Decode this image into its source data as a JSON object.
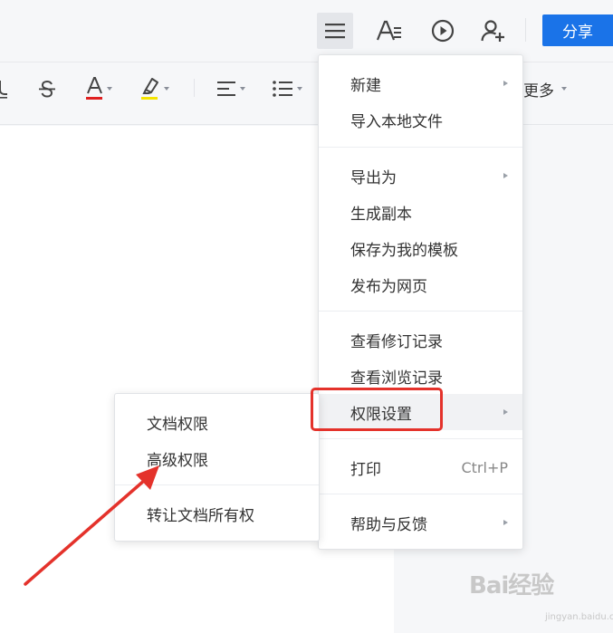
{
  "header": {
    "share_label": "分享"
  },
  "toolbar": {
    "more_label": "更多",
    "underline_glyph": "U",
    "strike_glyph": "S",
    "font_color_glyph": "A",
    "font_color": "#e02020",
    "highlight_color": "#f5e400"
  },
  "main_menu": {
    "items": [
      {
        "label": "新建",
        "submenu": true
      },
      {
        "label": "导入本地文件"
      },
      {
        "label": "导出为",
        "submenu": true
      },
      {
        "label": "生成副本"
      },
      {
        "label": "保存为我的模板"
      },
      {
        "label": "发布为网页"
      },
      {
        "label": "查看修订记录"
      },
      {
        "label": "查看浏览记录"
      },
      {
        "label": "权限设置",
        "submenu": true,
        "active": true
      },
      {
        "label": "打印",
        "shortcut": "Ctrl+P"
      },
      {
        "label": "帮助与反馈",
        "submenu": true
      }
    ]
  },
  "sub_menu": {
    "items": [
      {
        "label": "文档权限"
      },
      {
        "label": "高级权限"
      },
      {
        "label": "转让文档所有权"
      }
    ]
  },
  "annotation": {
    "box_color": "#e4322b",
    "arrow_color": "#e4322b"
  },
  "watermark": {
    "text": "Bai经验",
    "sub": "jingyan.baidu.com"
  }
}
